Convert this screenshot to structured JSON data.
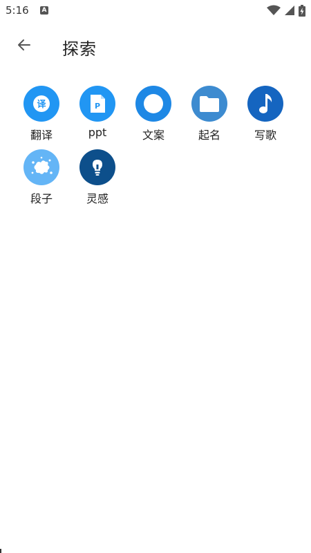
{
  "status_bar": {
    "time": "5:16",
    "notification_icon": "a-icon",
    "icons": [
      "wifi-icon",
      "cellular-icon",
      "battery-charging-icon"
    ]
  },
  "app_bar": {
    "back_icon": "arrow-left-icon",
    "title": "探索"
  },
  "tools": [
    {
      "label": "翻译",
      "icon": "translate-icon",
      "icon_text": "译",
      "color": "#2196F3"
    },
    {
      "label": "ppt",
      "icon": "ppt-file-icon",
      "icon_text": "P",
      "color": "#2196F3"
    },
    {
      "label": "文案",
      "icon": "circle-icon",
      "color": "#1E88E5"
    },
    {
      "label": "起名",
      "icon": "folder-icon",
      "color": "#3D8BD0"
    },
    {
      "label": "写歌",
      "icon": "music-note-icon",
      "color": "#1565C0"
    },
    {
      "label": "段子",
      "icon": "splash-icon",
      "color": "#64B5F6"
    },
    {
      "label": "灵感",
      "icon": "lightbulb-icon",
      "color": "#0D4F8B"
    }
  ]
}
